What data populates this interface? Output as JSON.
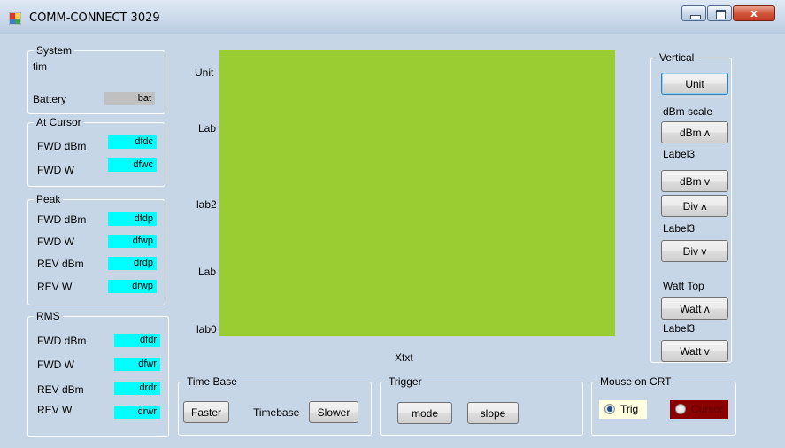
{
  "window": {
    "title": "COMM-CONNECT 3029",
    "controls": {
      "minimize": "–",
      "maximize": "□",
      "close": "x"
    }
  },
  "system": {
    "legend": "System",
    "tim": "tim",
    "battery_label": "Battery",
    "battery_value": "bat"
  },
  "at_cursor": {
    "legend": "At Cursor",
    "rows": [
      {
        "label": "FWD dBm",
        "value": "dfdc"
      },
      {
        "label": "FWD W",
        "value": "dfwc"
      }
    ]
  },
  "peak": {
    "legend": "Peak",
    "rows": [
      {
        "label": "FWD dBm",
        "value": "dfdp"
      },
      {
        "label": "FWD W",
        "value": "dfwp"
      },
      {
        "label": "REV dBm",
        "value": "drdp"
      },
      {
        "label": "REV W",
        "value": "drwp"
      }
    ]
  },
  "rms": {
    "legend": "RMS",
    "rows": [
      {
        "label": "FWD dBm",
        "value": "dfdr"
      },
      {
        "label": "FWD W",
        "value": "dfwr"
      },
      {
        "label": "REV dBm",
        "value": "drdr"
      },
      {
        "label": "REV W",
        "value": "drwr"
      }
    ]
  },
  "plot": {
    "background": "#9acd32",
    "y_labels": [
      "Unit",
      "Lab",
      "lab2",
      "Lab",
      "lab0"
    ],
    "x_label": "Xtxt"
  },
  "time_base": {
    "legend": "Time Base",
    "faster": "Faster",
    "label": "Timebase",
    "slower": "Slower"
  },
  "trigger": {
    "legend": "Trigger",
    "mode": "mode",
    "slope": "slope"
  },
  "mouse_on_crt": {
    "legend": "Mouse on CRT",
    "trig": "Trig",
    "cursor": "Cursor",
    "selected": "Trig",
    "trig_color": "#ffffe0",
    "cursor_color": "#8b0000"
  },
  "vertical": {
    "legend": "Vertical",
    "unit_button": "Unit",
    "dbm_scale_label": "dBm scale",
    "dbm_up": "dBm ʌ",
    "label3_a": "Label3",
    "dbm_down": "dBm v",
    "div_up": "Div ʌ",
    "label3_b": "Label3",
    "div_down": "Div v",
    "watt_top_label": "Watt Top",
    "watt_up": "Watt ʌ",
    "label3_c": "Label3",
    "watt_down": "Watt v"
  },
  "colors": {
    "form_bg": "#c7d6e6",
    "value_bg": "#00ffff",
    "battery_bg": "#c0c0c0"
  }
}
